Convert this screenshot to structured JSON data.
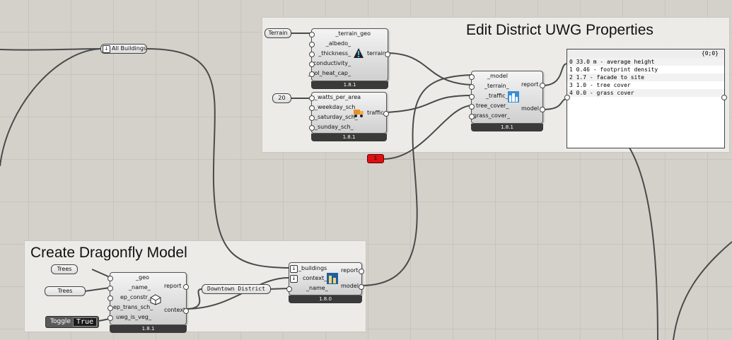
{
  "groups": {
    "uwg": {
      "title": "Edit District UWG Properties"
    },
    "dragonfly": {
      "title": "Create Dragonfly Model"
    }
  },
  "params": {
    "all_buildings": "All Buildings",
    "terrain": "Terrain",
    "twenty": "20",
    "red_value": "1",
    "trees1": "Trees",
    "trees2": "Trees",
    "downtown": "Downtown District"
  },
  "toggle": {
    "label": "Toggle",
    "value": "True"
  },
  "components": {
    "terrain": {
      "inputs": [
        "_terrain_geo",
        "_albedo_",
        "_thickness_",
        "_conductivity_",
        "_vol_heat_cap_"
      ],
      "outputs": [
        "terrain"
      ],
      "version": "1.8.1",
      "icon": "warning-cone-icon"
    },
    "traffic": {
      "inputs": [
        "_watts_per_area",
        "_weekday_sch_",
        "_saturday_sch_",
        "_sunday_sch_"
      ],
      "outputs": [
        "traffic"
      ],
      "version": "1.8.1",
      "icon": "truck-icon"
    },
    "uwg_props": {
      "inputs": [
        "_model",
        "_terrain_",
        "_traffic_",
        "tree_cover_",
        "grass_cover_"
      ],
      "outputs": [
        "report",
        "model"
      ],
      "version": "1.8.1",
      "icon": "city-icon"
    },
    "context": {
      "inputs": [
        "_geo",
        "_name_",
        "ep_constr_",
        "ep_trans_sch_",
        "uwg_is_veg_"
      ],
      "outputs": [
        "report",
        "context"
      ],
      "version": "1.8.1",
      "icon": "cube-icon"
    },
    "model": {
      "inputs": [
        "_buildings",
        "context_",
        "_name_"
      ],
      "outputs": [
        "report",
        "model"
      ],
      "version": "1.8.0",
      "icon": "building-icon"
    }
  },
  "panel": {
    "header": "{0;0}",
    "rows": [
      "0 33.0 m - average height",
      "1 0.46 - footprint density",
      "2 1.7 - facade to site",
      "3 1.0 - tree cover",
      "4 0.0 - grass cover"
    ]
  },
  "colors": {
    "wire": "#4a4a4a",
    "group_bg": "#eeede9",
    "red_param": "#dd1111"
  }
}
